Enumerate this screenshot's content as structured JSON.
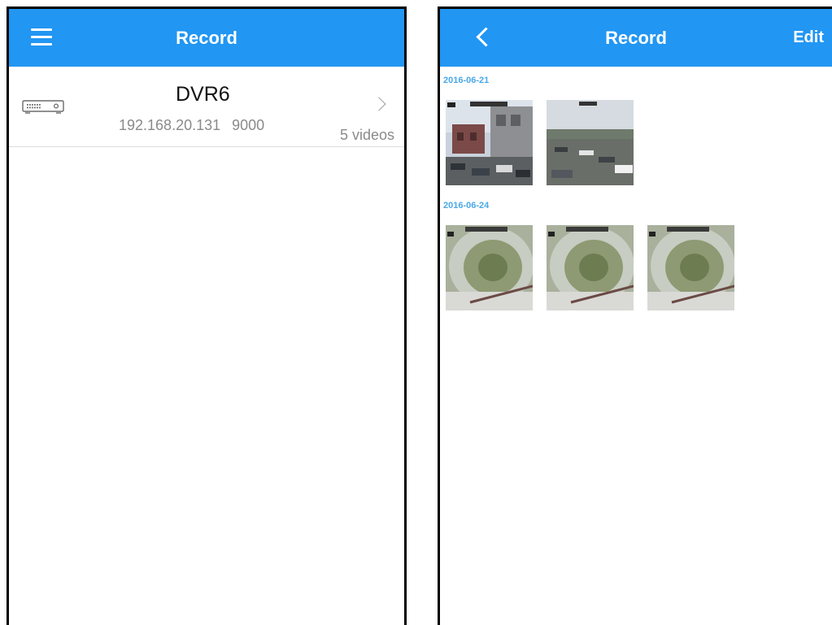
{
  "left": {
    "header": {
      "title": "Record",
      "menu_icon": "hamburger-menu-icon"
    },
    "device": {
      "icon": "dvr-device-icon",
      "name": "DVR6",
      "ip": "192.168.20.131",
      "port": "9000",
      "video_count": "5 videos",
      "chevron_icon": "chevron-right-icon"
    }
  },
  "right": {
    "header": {
      "title": "Record",
      "back_icon": "chevron-left-icon",
      "edit_label": "Edit"
    },
    "groups": [
      {
        "date": "2016-06-21",
        "thumbnails": [
          "street-scene-1",
          "street-scene-2"
        ]
      },
      {
        "date": "2016-06-24",
        "thumbnails": [
          "fisheye-scene-1",
          "fisheye-scene-2",
          "fisheye-scene-3"
        ]
      }
    ]
  },
  "colors": {
    "accent": "#2196f3",
    "date_label": "#4aa8e8",
    "subtext": "#8a8a8a",
    "divider": "#dcdcdc"
  }
}
